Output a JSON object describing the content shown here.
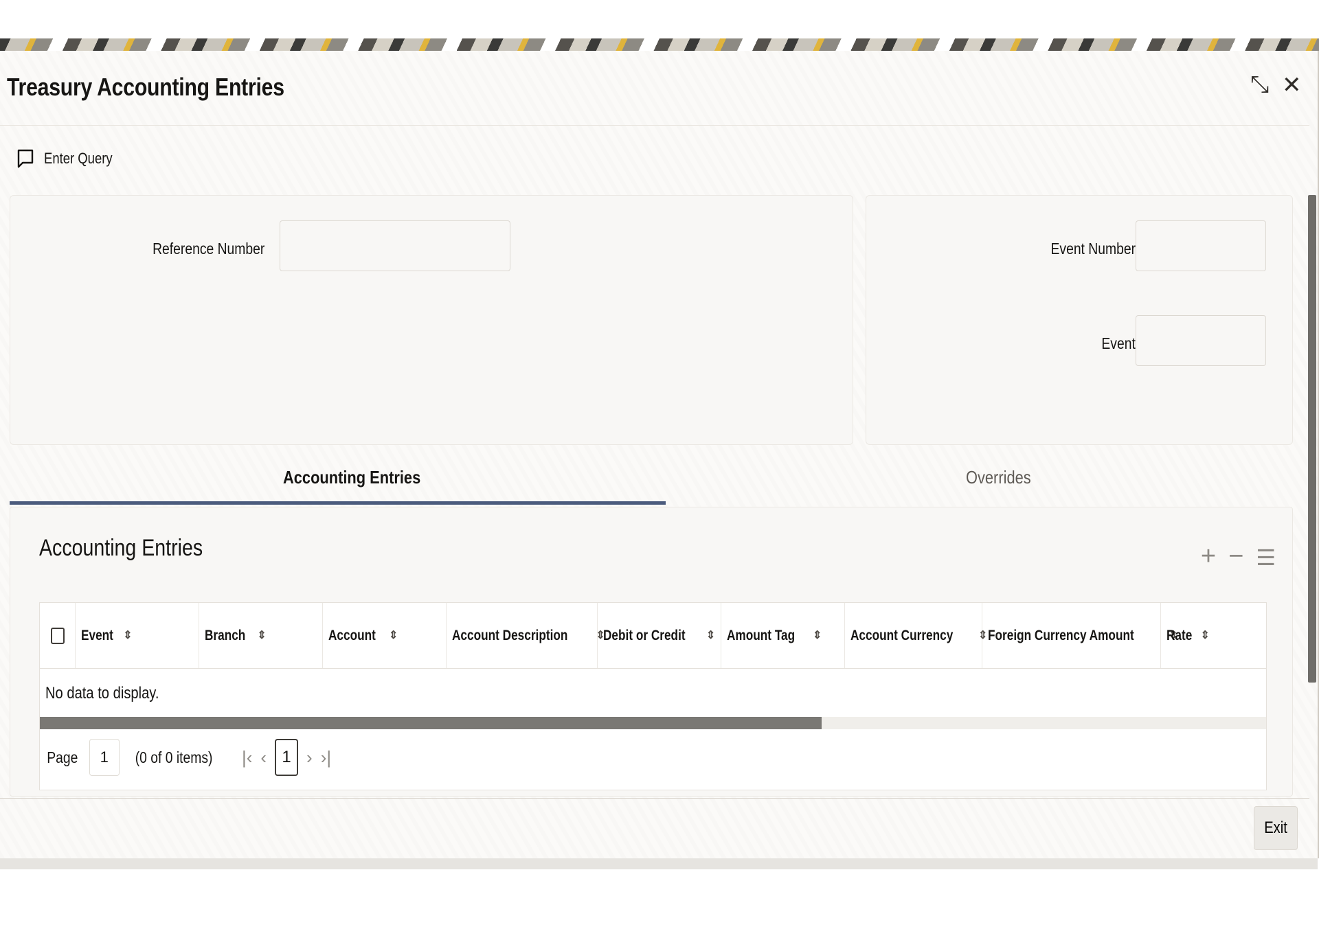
{
  "window": {
    "title": "Treasury Accounting Entries",
    "controls": {
      "restore_icon": "restore-icon",
      "close_icon": "close-icon",
      "restore_glyph": "⤡",
      "close_glyph": "✕"
    }
  },
  "toolbar": {
    "enter_query_label": "Enter Query",
    "enter_query_icon": "message-icon"
  },
  "form": {
    "reference_number": {
      "label": "Reference Number",
      "value": ""
    },
    "event_number": {
      "label": "Event Number",
      "value": ""
    },
    "event": {
      "label": "Event",
      "value": ""
    }
  },
  "tabs": [
    {
      "label": "Accounting Entries",
      "active": true
    },
    {
      "label": "Overrides",
      "active": false
    }
  ],
  "section": {
    "title": "Accounting Entries",
    "actions": {
      "add_glyph": "+",
      "remove_glyph": "−",
      "list_glyph": "☰"
    }
  },
  "table": {
    "columns": [
      "Event",
      "Branch",
      "Account",
      "Account Description",
      "Debit or Credit",
      "Amount Tag",
      "Account Currency",
      "Foreign Currency Amount",
      "Rate"
    ],
    "sort_glyph": "⇕",
    "empty_message": "No data to display."
  },
  "pagination": {
    "page_label": "Page",
    "page_input": "1",
    "summary": "(0 of 0 items)",
    "current_page": "1",
    "first_glyph": "|‹",
    "prev_glyph": "‹",
    "next_glyph": "›",
    "last_glyph": "›|"
  },
  "footer": {
    "exit_label": "Exit"
  },
  "colors": {
    "tab_underline": "#4b5b7d",
    "scroll_thumb": "#7a7874"
  }
}
